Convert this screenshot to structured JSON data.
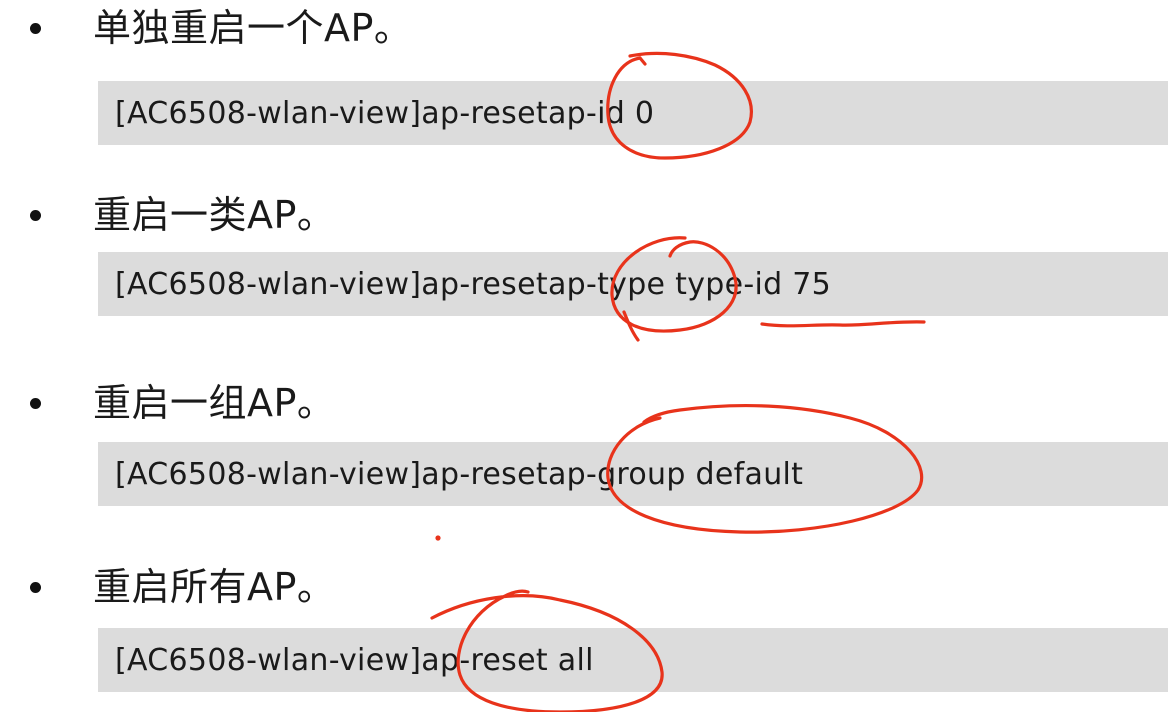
{
  "sections": [
    {
      "heading": "单独重启一个AP。",
      "command_prefix": "[AC6508-wlan-view]ap-reset ",
      "command_arg": "ap-id 0"
    },
    {
      "heading": "重启一类AP。",
      "command_prefix": "[AC6508-wlan-view]ap-reset ",
      "command_arg": "ap-type type-id 75"
    },
    {
      "heading": "重启一组AP。",
      "command_prefix": "[AC6508-wlan-view]ap-reset ",
      "command_arg": "ap-group default"
    },
    {
      "heading": "重启所有AP。",
      "command_prefix": "[AC6508-wlan-view]",
      "command_arg": "ap-reset all"
    }
  ],
  "colors": {
    "annotation": "#e8331b",
    "code_background": "#dcdcdc",
    "text": "#1a1a1a"
  }
}
